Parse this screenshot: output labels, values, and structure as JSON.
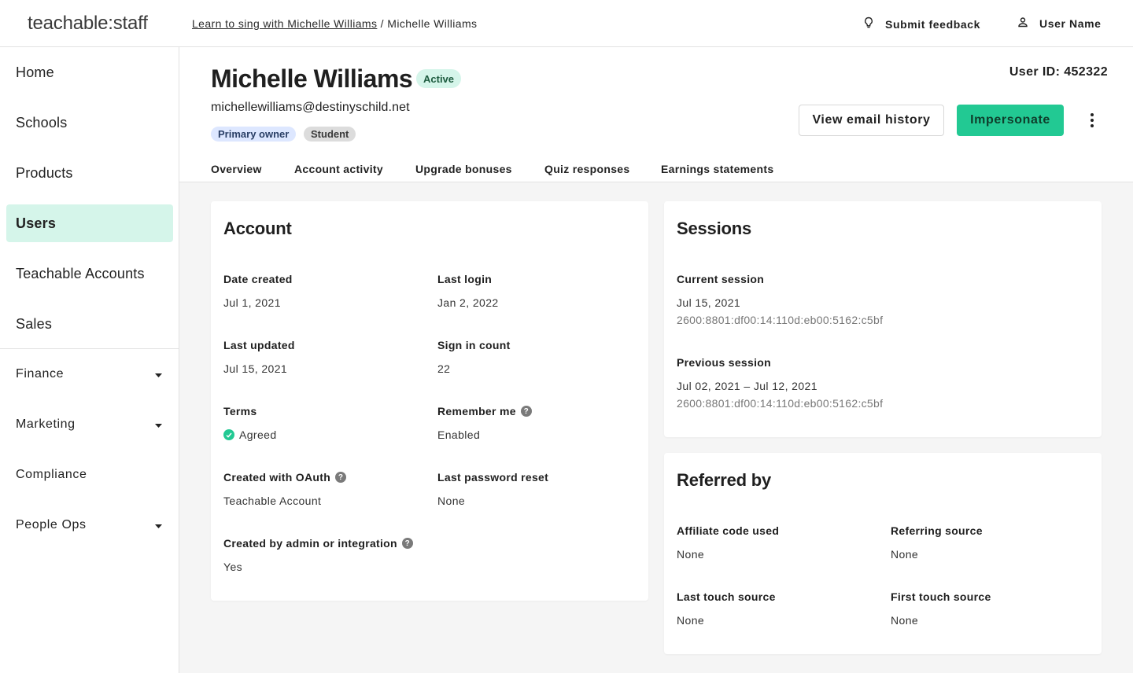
{
  "app": {
    "logo": "teachable:staff"
  },
  "breadcrumb": {
    "link": "Learn to sing with Michelle Williams",
    "separator": "/",
    "current": "Michelle Williams"
  },
  "topbar": {
    "feedback_label": "Submit feedback",
    "feedback_icon": "lightbulb-icon",
    "user_label": "User Name",
    "user_icon": "user-icon"
  },
  "sidebar": {
    "items": [
      {
        "label": "Home"
      },
      {
        "label": "Schools"
      },
      {
        "label": "Products"
      },
      {
        "label": "Users",
        "active": true
      },
      {
        "label": "Teachable Accounts"
      },
      {
        "label": "Sales"
      }
    ],
    "sections": [
      {
        "label": "Finance",
        "expandable": true
      },
      {
        "label": "Marketing",
        "expandable": true
      },
      {
        "label": "Compliance",
        "expandable": false
      },
      {
        "label": "People Ops",
        "expandable": true
      }
    ]
  },
  "profile": {
    "name": "Michelle Williams",
    "status": "Active",
    "email": "michellewilliams@destinyschild.net",
    "roles": [
      "Primary owner",
      "Student"
    ],
    "user_id": "User ID: 452322"
  },
  "actions": {
    "email_history": "View email history",
    "impersonate": "Impersonate"
  },
  "tabs": [
    {
      "label": "Overview"
    },
    {
      "label": "Account activity",
      "active": true
    },
    {
      "label": "Upgrade bonuses"
    },
    {
      "label": "Quiz responses"
    },
    {
      "label": "Earnings statements"
    }
  ],
  "account": {
    "title": "Account",
    "fields": {
      "date_created": {
        "label": "Date created",
        "value": "Jul 1, 2021"
      },
      "last_login": {
        "label": "Last login",
        "value": "Jan 2, 2022"
      },
      "last_updated": {
        "label": "Last updated",
        "value": "Jul 15, 2021"
      },
      "sign_in_count": {
        "label": "Sign in count",
        "value": "22"
      },
      "terms": {
        "label": "Terms",
        "value": "Agreed"
      },
      "remember_me": {
        "label": "Remember me",
        "value": "Enabled"
      },
      "oauth": {
        "label": "Created with OAuth",
        "value": "Teachable Account"
      },
      "password_reset": {
        "label": "Last password reset",
        "value": "None"
      },
      "admin_created": {
        "label": "Created by admin or integration",
        "value": "Yes"
      }
    }
  },
  "sessions": {
    "title": "Sessions",
    "current": {
      "label": "Current session",
      "date": "Jul 15, 2021",
      "ip": "2600:8801:df00:14:110d:eb00:5162:c5bf"
    },
    "previous": {
      "label": "Previous session",
      "date": "Jul 02, 2021 – Jul 12, 2021",
      "ip": "2600:8801:df00:14:110d:eb00:5162:c5bf"
    }
  },
  "referred": {
    "title": "Referred by",
    "fields": {
      "affiliate": {
        "label": "Affiliate code used",
        "value": "None"
      },
      "referring": {
        "label": "Referring source",
        "value": "None"
      },
      "last_touch": {
        "label": "Last touch source",
        "value": "None"
      },
      "first_touch": {
        "label": "First touch source",
        "value": "None"
      }
    }
  },
  "colors": {
    "accent": "#22c993",
    "active_nav_bg": "#d5f5ea",
    "badge_primary": "#dde7ff",
    "badge_student": "#dcdcdc"
  }
}
